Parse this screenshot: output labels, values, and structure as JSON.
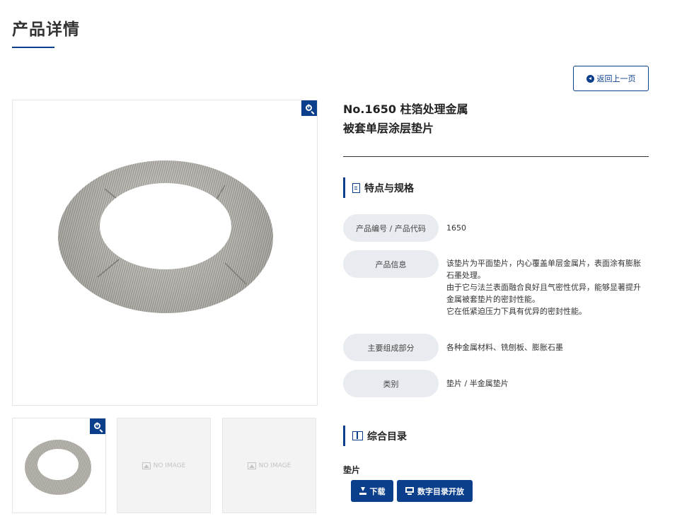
{
  "page": {
    "title": "产品详情"
  },
  "back_button": {
    "label": "返回上一页"
  },
  "product": {
    "title_line1": "No.1650 柱箔处理金属",
    "title_line2": "被套单层涂层垫片"
  },
  "gallery": {
    "placeholder_1": "NO IMAGE",
    "placeholder_2": "NO IMAGE"
  },
  "specs": {
    "heading": "特点与规格",
    "rows": [
      {
        "label": "产品编号 / 产品代码",
        "value": "1650"
      },
      {
        "label": "产品信息",
        "value_lines": [
          "该垫片为平面垫片，内心覆盖单层金属片，表面涂有膨胀",
          "石墨处理。",
          "由于它与法兰表面融合良好且气密性优异，能够显著提升",
          "金属被套垫片的密封性能。",
          "它在低紧迫压力下具有优异的密封性能。"
        ]
      },
      {
        "label": "主要组成部分",
        "value": "各种金属材料、铣刨板、膨胀石墨"
      },
      {
        "label": "类别",
        "value": "垫片 / 半金属垫片"
      }
    ]
  },
  "catalog": {
    "heading": "综合目录",
    "item_label": "垫片",
    "download_label": "下载",
    "digital_label": "数字目录开放"
  },
  "icons": [
    "arrow-left-circle-icon",
    "zoom-in-icon",
    "document-icon",
    "book-icon",
    "download-icon",
    "monitor-icon",
    "image-placeholder-icon"
  ],
  "colors": {
    "accent": "#0b3f8c",
    "label_bg": "#e8ecf0",
    "placeholder_bg": "#f3f3f3"
  }
}
